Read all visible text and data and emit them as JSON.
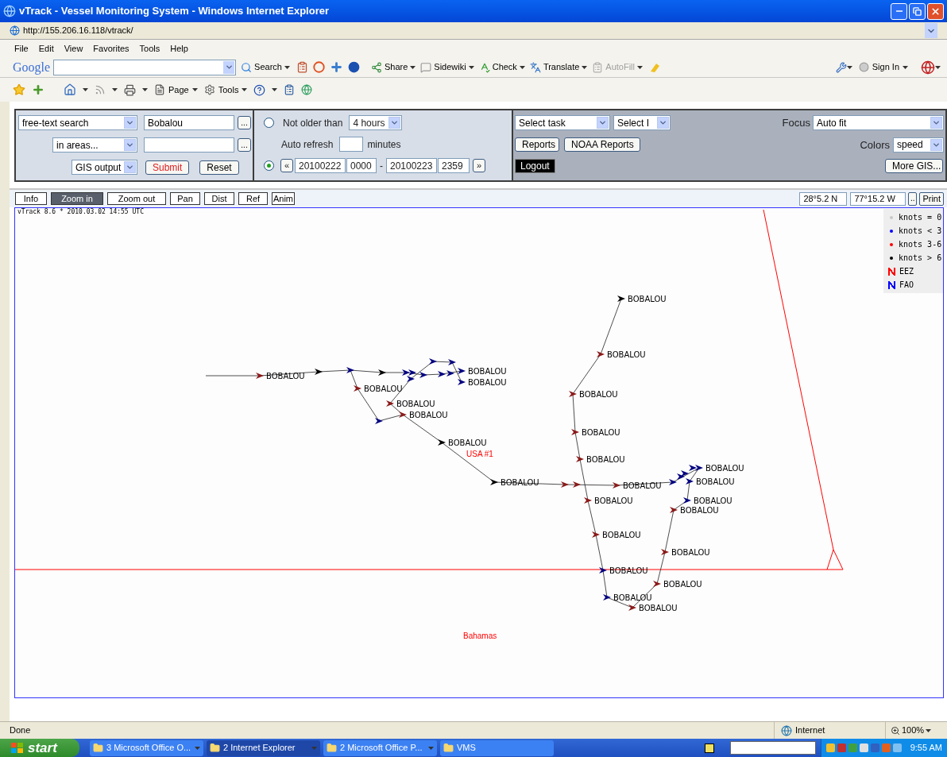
{
  "window": {
    "title": "vTrack - Vessel Monitoring System - Windows Internet Explorer"
  },
  "address_bar": {
    "url": "http://155.206.16.118/vtrack/"
  },
  "menu_bar": [
    "File",
    "Edit",
    "View",
    "Favorites",
    "Tools",
    "Help"
  ],
  "google_toolbar": {
    "logo": "Google",
    "items": [
      {
        "label": "Search",
        "disabled": false
      },
      {
        "label": "Share",
        "disabled": false
      },
      {
        "label": "Sidewiki",
        "disabled": false
      },
      {
        "label": "Check",
        "disabled": false
      },
      {
        "label": "Translate",
        "disabled": false
      },
      {
        "label": "AutoFill",
        "disabled": true
      }
    ],
    "sign_in": "Sign In"
  },
  "command_bar": [
    "Page",
    "Tools"
  ],
  "search_panel": {
    "search_type": "free-text search",
    "search_value": "Bobalou",
    "area_type": "in areas...",
    "output_type": "GIS output",
    "browse": "...",
    "submit": "Submit",
    "reset": "Reset"
  },
  "time_panel": {
    "modes": [
      {
        "selected": false
      },
      {
        "selected": true
      }
    ],
    "not_older_label": "Not older than",
    "age": "4 hours",
    "auto_refresh_label": "Auto refresh",
    "auto_refresh_unit": "minutes",
    "prev": "«",
    "from_date": "20100222",
    "from_time": "0000",
    "separator": "-",
    "to_date": "20100223",
    "to_time": "2359",
    "next": "»"
  },
  "task_panel": {
    "task": "Select task",
    "select_2": "Select I",
    "buttons": [
      "Reports",
      "NOAA Reports"
    ],
    "logout": "Logout",
    "focus_label": "Focus",
    "focus": "Auto fit",
    "colors_label": "Colors",
    "colors": "speed",
    "more_gis": "More GIS..."
  },
  "map_tools": [
    {
      "label": "Info",
      "selected": false
    },
    {
      "label": "Zoom in",
      "selected": true
    },
    {
      "label": "Zoom out",
      "selected": false
    },
    {
      "label": "Pan",
      "selected": false
    },
    {
      "label": "Dist",
      "selected": false
    },
    {
      "label": "Ref",
      "selected": false
    },
    {
      "label": "Anim",
      "selected": false
    }
  ],
  "coordinates": {
    "lat": "28°5.2 N",
    "lon": "77°15.2 W",
    "more": "..",
    "print": "Print"
  },
  "map": {
    "stamp": "vTrack 8.6 * 2010.03.02 14:55 UTC",
    "legend": [
      {
        "kind": "dot",
        "color": "#c8c8c8",
        "label": "knots = 0"
      },
      {
        "kind": "dot",
        "color": "#0000ff",
        "label": "knots < 3"
      },
      {
        "kind": "dot",
        "color": "#ff0000",
        "label": "knots 3-6"
      },
      {
        "kind": "dot",
        "color": "#000000",
        "label": "knots > 6"
      },
      {
        "kind": "line",
        "color": "#ff0000",
        "label": "EEZ"
      },
      {
        "kind": "line",
        "color": "#0000ff",
        "label": "FAO"
      }
    ],
    "positions": [
      {
        "label": "BOBALOU",
        "color": "#000000"
      },
      {
        "label": "BOBALOU",
        "color": "#8b1a1a"
      },
      {
        "label": "BOBALOU",
        "color": "#000080"
      },
      {
        "label": "BOBALOU",
        "color": "#8b1a1a"
      },
      {
        "label": "BOBALOU",
        "color": "#000080"
      },
      {
        "label": "BOBALOU",
        "color": "#8b1a1a"
      },
      {
        "label": "BOBALOU",
        "color": "#8b1a1a"
      },
      {
        "label": "BOBALOU",
        "color": "#8b1a1a"
      },
      {
        "label": "BOBALOU",
        "color": "#8b1a1a"
      },
      {
        "label": "BOBALOU",
        "color": "#8b1a1a"
      },
      {
        "label": "BOBALOU",
        "color": "#000000"
      },
      {
        "label": "BOBALOU",
        "color": "#8b1a1a"
      },
      {
        "label": "BOBALOU",
        "color": "#000080"
      },
      {
        "label": "BOBALOU",
        "color": "#000080"
      },
      {
        "label": "BOBALOU",
        "color": "#000000"
      },
      {
        "label": "BOBALOU",
        "color": "#8b1a1a"
      },
      {
        "label": "BOBALOU",
        "color": "#8b1a1a"
      },
      {
        "label": "BOBALOU",
        "color": "#000080"
      },
      {
        "label": "BOBALOU",
        "color": "#8b1a1a"
      },
      {
        "label": "BOBALOU",
        "color": "#8b1a1a"
      },
      {
        "label": "BOBALOU",
        "color": "#8b1a1a"
      },
      {
        "label": "BOBALOU",
        "color": "#000080"
      },
      {
        "label": "BOBALOU",
        "color": "#8b1a1a"
      },
      {
        "label": "BOBALOU",
        "color": "#000080"
      },
      {
        "label": "BOBALOU",
        "color": "#8b1a1a"
      }
    ],
    "places": [
      "USA #1",
      "Bahamas"
    ]
  },
  "status_bar": {
    "text": "Done",
    "zone": "Internet",
    "zoom": "100%"
  },
  "taskbar": {
    "start": "start",
    "tasks": [
      {
        "label": "3 Microsoft Office O...",
        "selected": false
      },
      {
        "label": "2 Internet Explorer",
        "selected": true
      },
      {
        "label": "2 Microsoft Office P...",
        "selected": false
      },
      {
        "label": "VMS",
        "selected": false
      }
    ],
    "clock": "9:55 AM"
  }
}
